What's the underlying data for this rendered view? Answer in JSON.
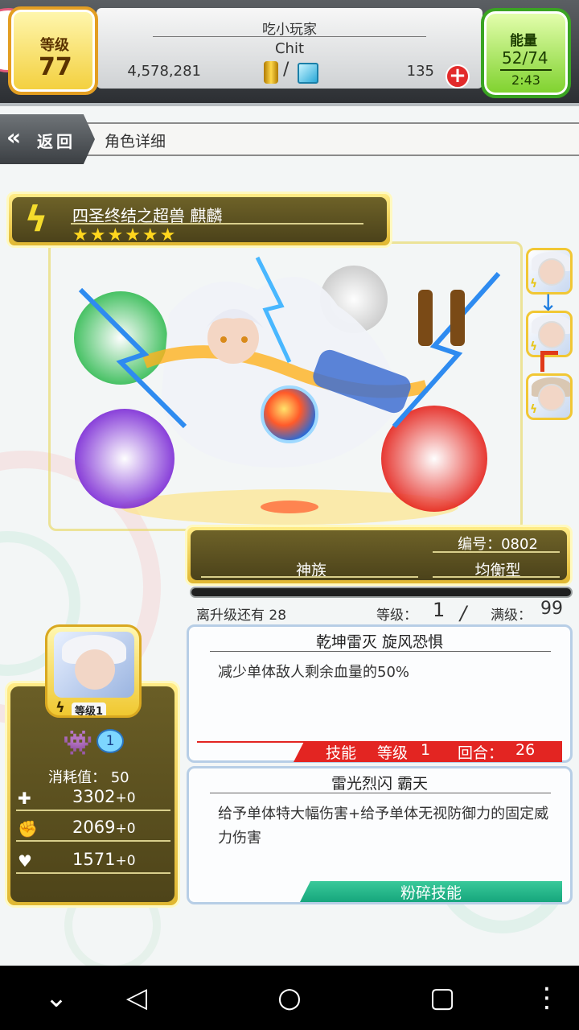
{
  "hud": {
    "level_label": "等级",
    "level_value": "77",
    "player_name": "吃小玩家",
    "guild": "Chit",
    "gold": "4,578,281",
    "slash": "/",
    "gems": "135",
    "plus": "+",
    "energy_label": "能量",
    "energy_value": "52/74",
    "energy_timer": "2:43"
  },
  "nav": {
    "back_label": "返回",
    "page_title": "角色详细"
  },
  "character": {
    "name": "四圣终结之超兽 麒麟",
    "stars": "★★★★★★",
    "star_count": 6,
    "number": "编号：0802",
    "race": "神族",
    "type": "均衡型"
  },
  "progress": {
    "exp_text": "离升级还有 28",
    "level_label": "等级：",
    "level_value": "1",
    "slash": "/",
    "max_label": "满级：",
    "max_value": "99",
    "exp_fraction": 0.0
  },
  "stats": {
    "portrait_level": "等级1",
    "token_value": "1",
    "cost": "消耗值：  50",
    "hp": "3302",
    "attack": "2069",
    "speed": "1571",
    "bonus": "+0"
  },
  "skills": [
    {
      "title": "乾坤雷灭 旋风恐惧",
      "desc": "减少单体敌人剩余血量的50%",
      "tag": "技能",
      "level_label": "等级",
      "level": "1",
      "turn_label": "回合：",
      "turns": "26"
    },
    {
      "title": "雷光烈闪 霸天",
      "desc": "给予单体特大幅伤害+给予单体无视防御力的固定威力伤害",
      "tag": "粉碎技能"
    }
  ],
  "colors": {
    "level_yellow": "#f3cf3c",
    "energy_green": "#7ed12c",
    "skill_red": "#e32522",
    "skill_teal": "#16a67c",
    "panel_olive": "#4e4419"
  }
}
